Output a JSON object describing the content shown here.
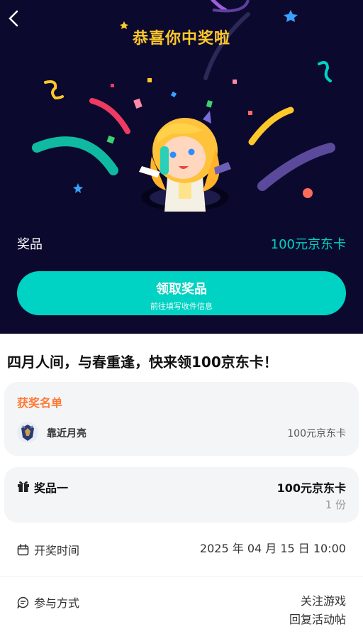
{
  "hero": {
    "title": "恭喜你中奖啦",
    "prize_label": "奖品",
    "prize_value": "100元京东卡",
    "claim_button": "领取奖品",
    "claim_subtext": "前往填写收件信息"
  },
  "headline": "四月人间，与春重逢，快来领100京东卡！",
  "winners": {
    "title": "获奖名单",
    "items": [
      {
        "name": "靠近月亮",
        "prize": "100元京东卡"
      }
    ]
  },
  "prize_one": {
    "label": "奖品一",
    "value": "100元京东卡",
    "quantity": "1 份"
  },
  "draw_time": {
    "label": "开奖时间",
    "value": "2025 年 04 月 15 日 10:00"
  },
  "participation": {
    "label": "参与方式",
    "methods": [
      "关注游戏",
      "回复活动帖"
    ]
  },
  "colors": {
    "hero_bg": "#0b0a2e",
    "title_yellow": "#ffc82a",
    "accent_teal": "#00d3c3",
    "winner_orange": "#ff7a36"
  }
}
